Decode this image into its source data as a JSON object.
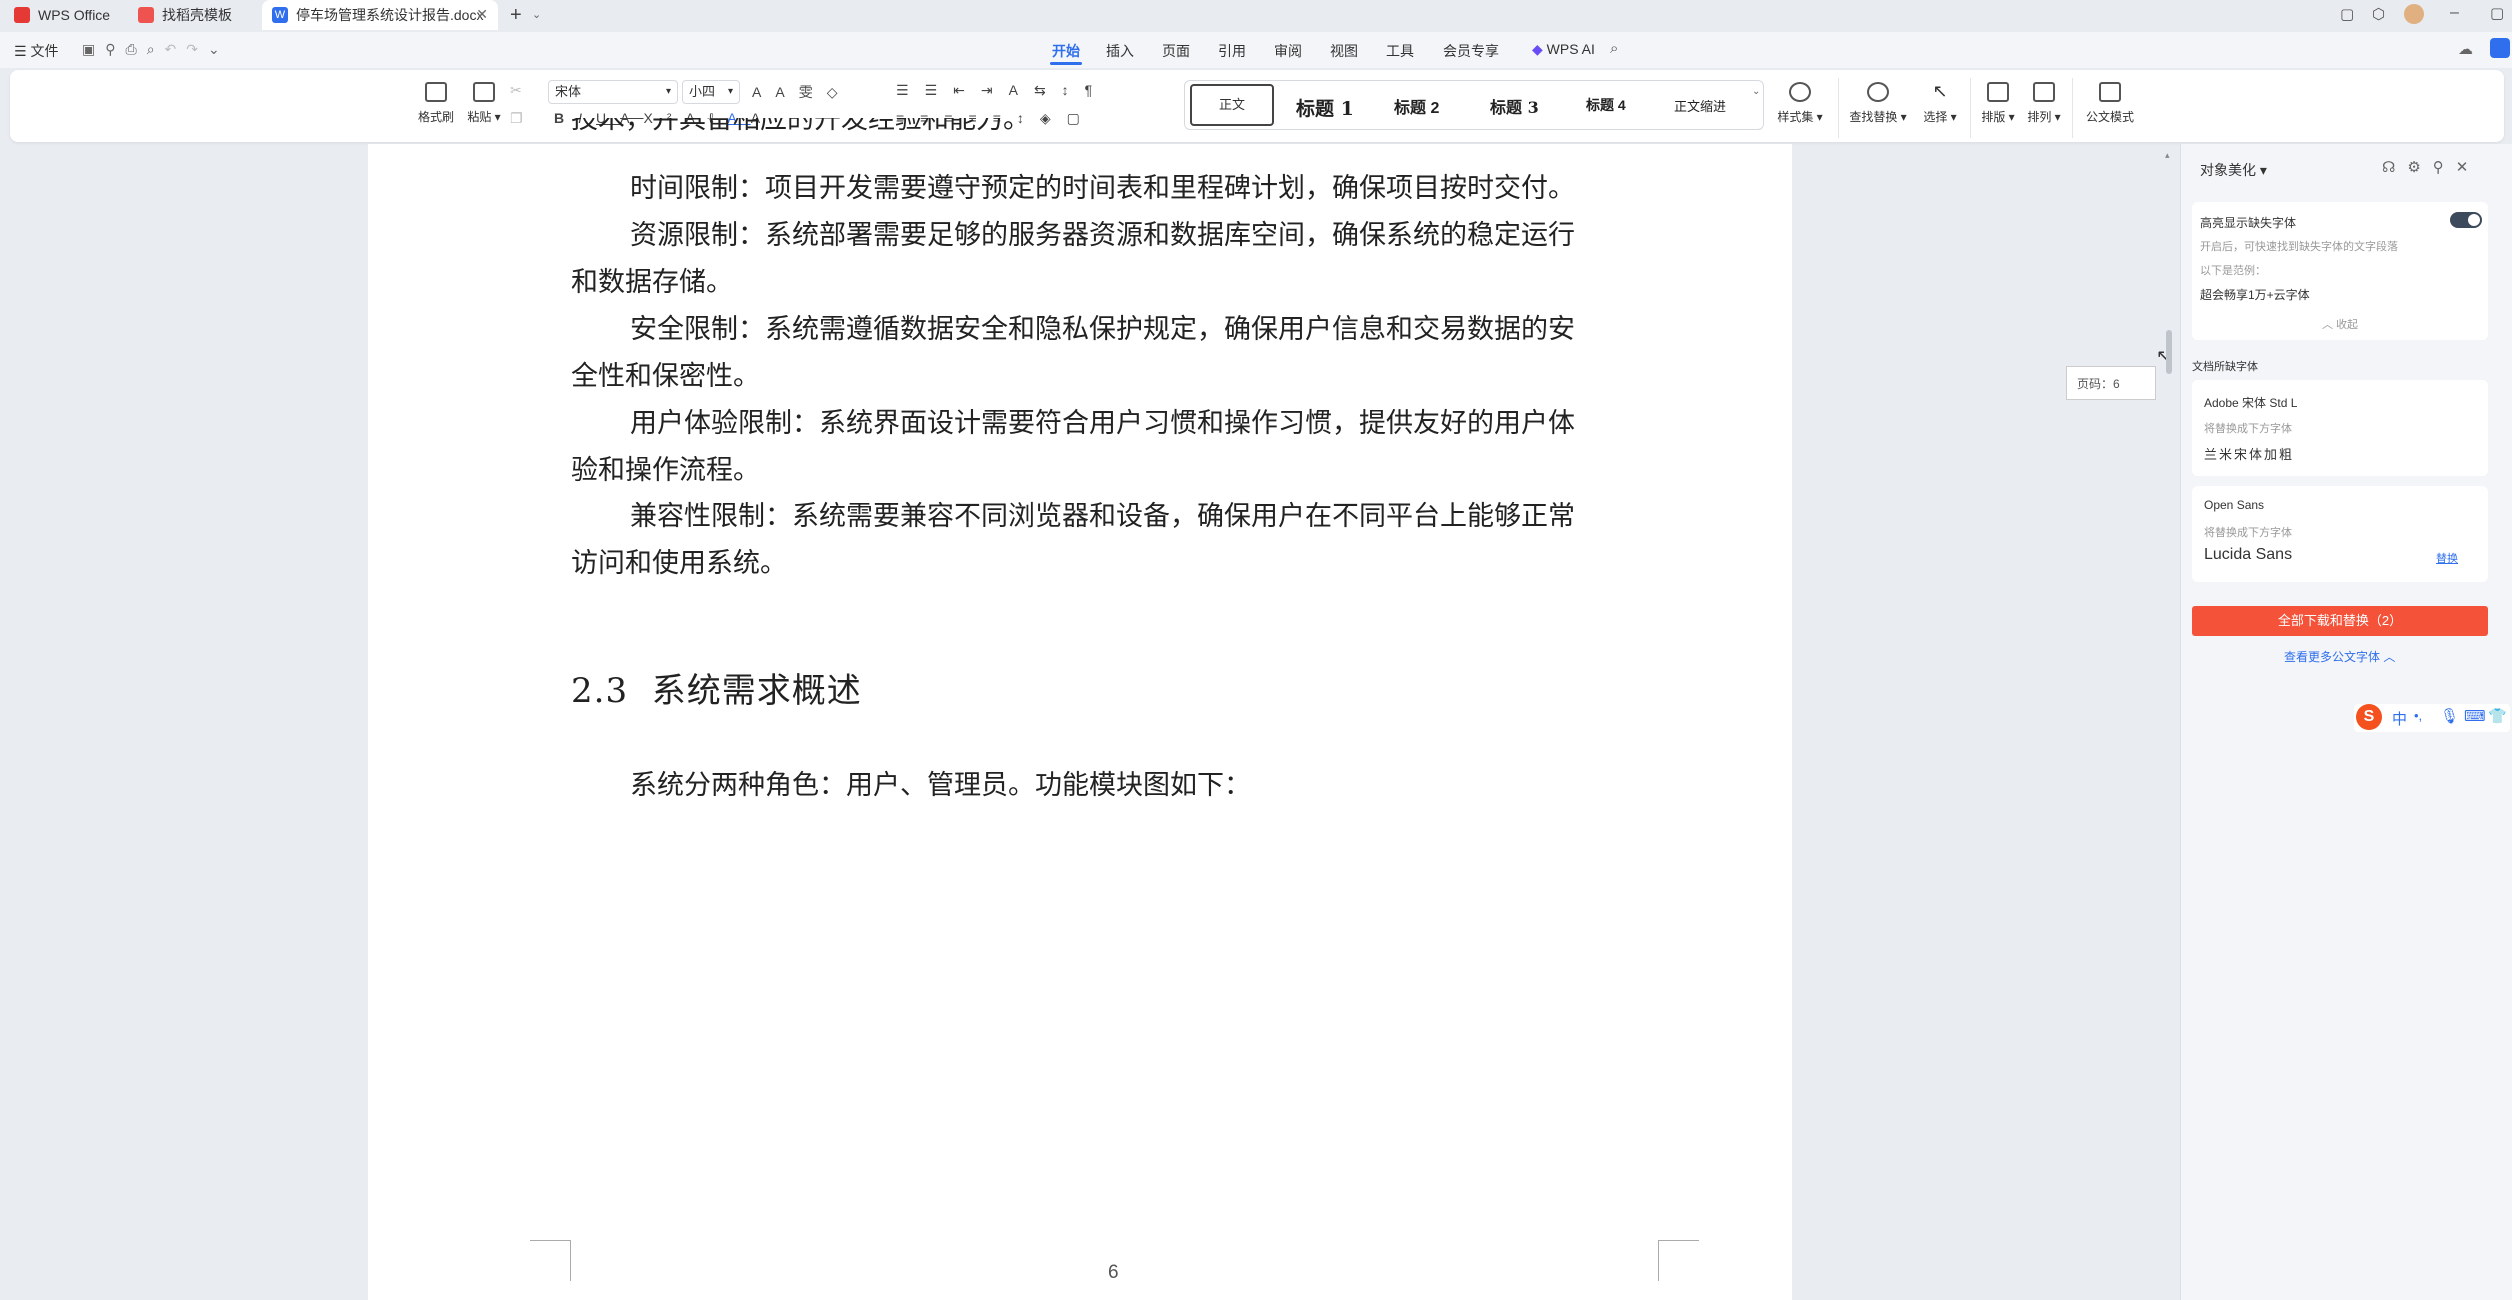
{
  "tabs": [
    {
      "label": "WPS Office",
      "color": "#e53935"
    },
    {
      "label": "找稻壳模板",
      "color": "#ef5350"
    },
    {
      "label": "停车场管理系统设计报告.docx",
      "color": "#2f6fed"
    }
  ],
  "menu": {
    "file": "文件",
    "items": [
      "开始",
      "插入",
      "页面",
      "引用",
      "审阅",
      "视图",
      "工具",
      "会员专享"
    ],
    "active": "开始",
    "wps_ai": "WPS AI"
  },
  "ribbon": {
    "format_painter": "格式刷",
    "paste": "粘贴",
    "font_name": "宋体",
    "font_size": "小四",
    "styles": [
      "正文",
      "标题 1",
      "标题 2",
      "标题 3",
      "标题 4",
      "正文缩进"
    ],
    "style_set": "样式集",
    "find_replace": "查找替换",
    "select": "选择",
    "layout": "排版",
    "arrange": "排列",
    "official_mode": "公文模式"
  },
  "document": {
    "top_fragment": "技术，并具备相应的开发经验和能力。",
    "paragraphs": [
      [
        "时间限制：项目开发需要遵守预定的时间表和里程碑计划，确保项目按时交付。"
      ],
      [
        "资源限制：系统部署需要足够的服务器资源和数据库空间，确保系统的稳定运行",
        "和数据存储。"
      ],
      [
        "安全限制：系统需遵循数据安全和隐私保护规定，确保用户信息和交易数据的安",
        "全性和保密性。"
      ],
      [
        "用户体验限制：系统界面设计需要符合用户习惯和操作习惯，提供友好的用户体",
        "验和操作流程。"
      ],
      [
        "兼容性限制：系统需要兼容不同浏览器和设备，确保用户在不同平台上能够正常",
        "访问和使用系统。"
      ]
    ],
    "heading_number": "2.3",
    "heading_text": "系统需求概述",
    "body": "系统分两种角色：用户、管理员。功能模块图如下：",
    "page_number": "6",
    "page_tooltip": "页码：6"
  },
  "panel": {
    "title": "对象美化",
    "highlight_title": "高亮显示缺失字体",
    "highlight_desc": "开启后，可快速找到缺失字体的文字段落",
    "sample_label": "以下是范例：",
    "sample_text": "超会畅享1万+云字体",
    "collapse": "收起",
    "missing_title": "文档所缺字体",
    "fonts": [
      {
        "name": "Adobe 宋体 Std L",
        "hint": "将替换成下方字体",
        "replacement": "兰米宋体加粗",
        "action": ""
      },
      {
        "name": "Open Sans",
        "hint": "将替换成下方字体",
        "replacement": "Lucida Sans",
        "action": "替换"
      }
    ],
    "download_button": "全部下载和替换（2）",
    "more_link": "查看更多公文字体"
  },
  "ime": {
    "labels": [
      "中",
      "•,"
    ]
  },
  "colors": {
    "accent": "#2f6fed",
    "download": "#f4533a"
  }
}
